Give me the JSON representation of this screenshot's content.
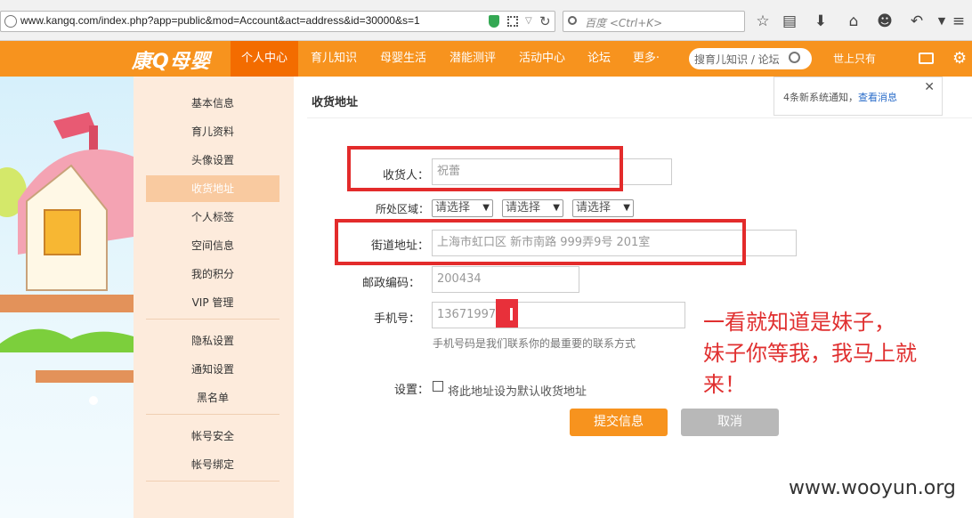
{
  "browser": {
    "url": "www.kangq.com/index.php?app=public&mod=Account&act=address&id=30000&s=1",
    "search_placeholder": "百度 <Ctrl+K>"
  },
  "site": {
    "logo": "康Q母婴",
    "nav": [
      "个人中心",
      "育儿知识",
      "母婴生活",
      "潜能测评",
      "活动中心",
      "论坛",
      "更多·"
    ],
    "search_placeholder": "搜育儿知识 / 论坛",
    "user": "世上只有"
  },
  "sidebar": {
    "items": [
      "基本信息",
      "育儿资料",
      "头像设置",
      "收货地址",
      "个人标签",
      "空间信息",
      "我的积分",
      "VIP 管理",
      "隐私设置",
      "通知设置",
      "黑名单",
      "帐号安全",
      "帐号绑定"
    ]
  },
  "main": {
    "title": "收货地址",
    "form": {
      "recipient_label": "收货人：",
      "recipient_value": "祝蕾",
      "region_label": "所处区域：",
      "region_selects": [
        "请选择",
        "请选择",
        "请选择"
      ],
      "street_label": "街道地址：",
      "street_value": "上海市虹口区 新市南路 999弄9号 201室",
      "zip_label": "邮政编码：",
      "zip_value": "200434",
      "phone_label": "手机号：",
      "phone_value": "13671997",
      "phone_hint": "手机号码是我们联系你的最重要的联系方式",
      "setting_label": "设置：",
      "default_label": "将此地址设为默认收货地址",
      "submit": "提交信息",
      "cancel": "取消"
    }
  },
  "notification": {
    "text": "4条新系统通知，",
    "link": "查看消息"
  },
  "annotation": [
    "一看就知道是妹子，",
    "妹子你等我，我马上就",
    "来！"
  ],
  "watermark": "www.wooyun.org",
  "colors": {
    "brand": "#f7931e",
    "active_nav": "#f36c00",
    "submit": "#f7931e",
    "cancel": "#b8b8b8",
    "annotation": "#e03030"
  }
}
